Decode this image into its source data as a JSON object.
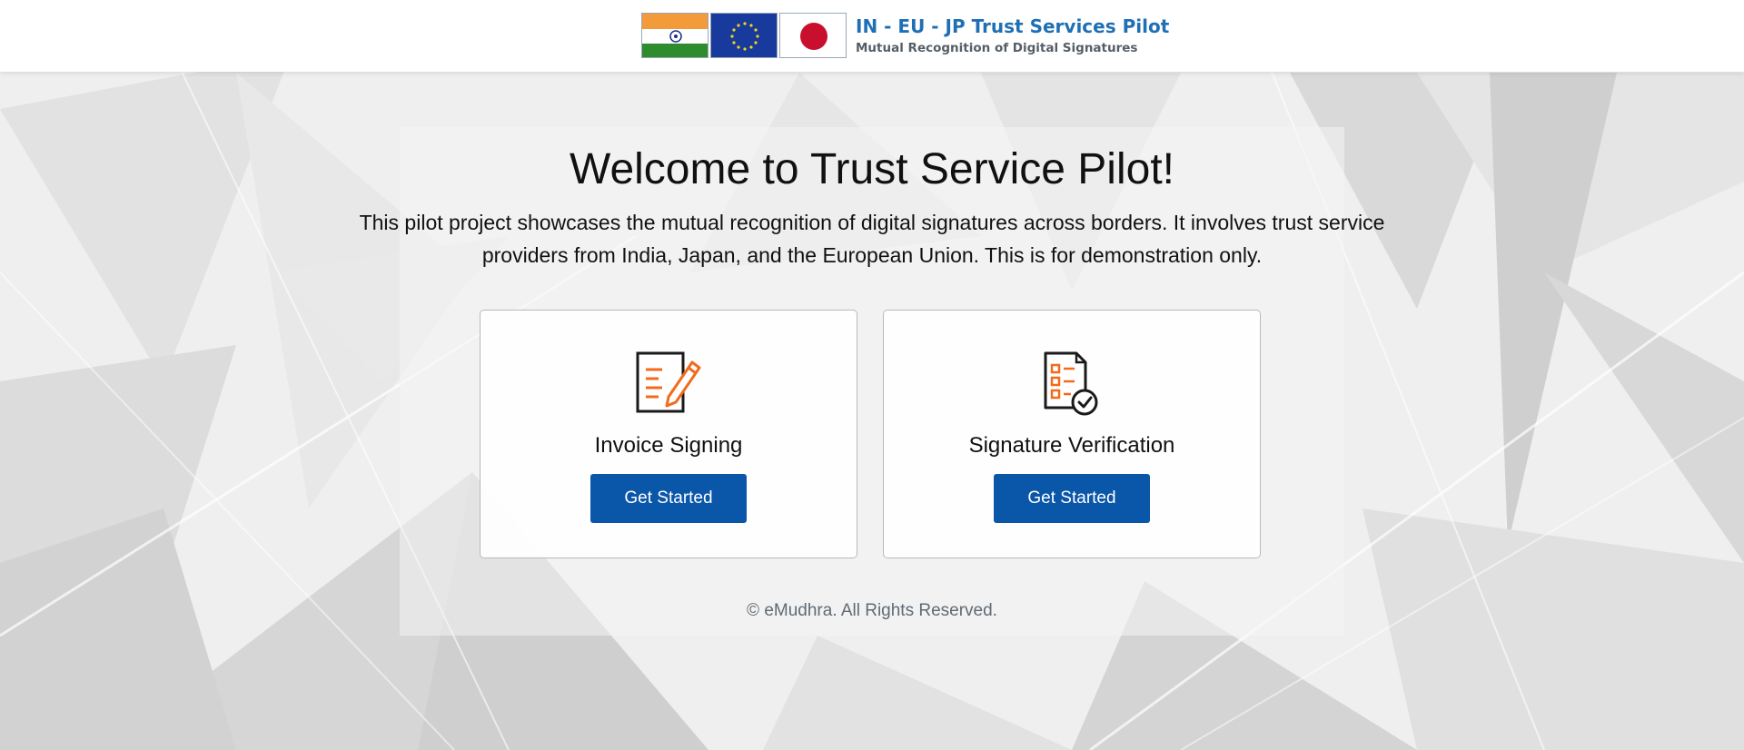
{
  "header": {
    "logo_title": "IN - EU - JP Trust Services Pilot",
    "logo_subtitle": "Mutual Recognition of Digital Signatures",
    "flags": [
      "india-flag-icon",
      "eu-flag-icon",
      "japan-flag-icon"
    ]
  },
  "main": {
    "title": "Welcome to Trust Service Pilot!",
    "description": "This pilot project showcases the mutual recognition of digital signatures across borders. It involves trust service providers from India, Japan, and the European Union. This is for demonstration only.",
    "cards": [
      {
        "icon": "document-sign-icon",
        "title": "Invoice Signing",
        "button_label": "Get Started"
      },
      {
        "icon": "checklist-verify-icon",
        "title": "Signature Verification",
        "button_label": "Get Started"
      }
    ]
  },
  "footer": {
    "copyright": "© eMudhra. All Rights Reserved."
  },
  "colors": {
    "primary_button": "#0a56a8",
    "brand_blue": "#1f6fb5",
    "icon_orange": "#f26b1d",
    "background": "#f1f1f1"
  }
}
